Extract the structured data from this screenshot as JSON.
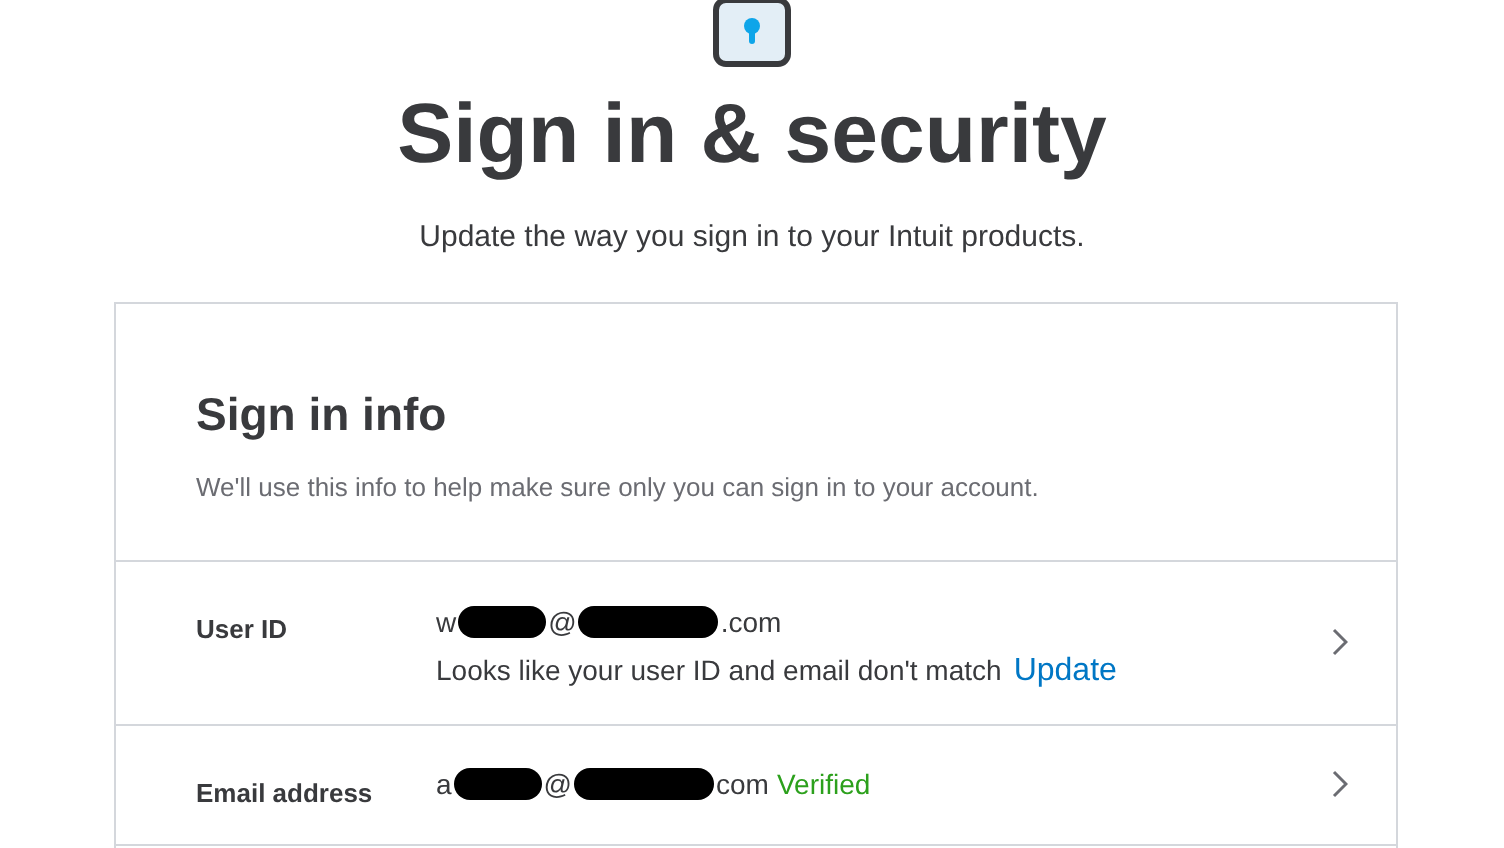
{
  "header": {
    "title": "Sign in & security",
    "subtitle": "Update the way you sign in to your Intuit products."
  },
  "card": {
    "title": "Sign in info",
    "description": "We'll use this info to help make sure only you can sign in to your account.",
    "rows": [
      {
        "label": "User ID",
        "value": [
          {
            "kind": "text",
            "text": "w"
          },
          {
            "kind": "redaction"
          },
          {
            "kind": "text",
            "text": "@"
          },
          {
            "kind": "redaction"
          },
          {
            "kind": "text",
            "text": ".com"
          }
        ],
        "note": "Looks like your user ID and email don't match",
        "link": "Update"
      },
      {
        "label": "Email address",
        "value": [
          {
            "kind": "text",
            "text": "a"
          },
          {
            "kind": "redaction"
          },
          {
            "kind": "text",
            "text": "@"
          },
          {
            "kind": "redaction"
          },
          {
            "kind": "text",
            "text": "com"
          }
        ],
        "status": "Verified"
      }
    ]
  }
}
